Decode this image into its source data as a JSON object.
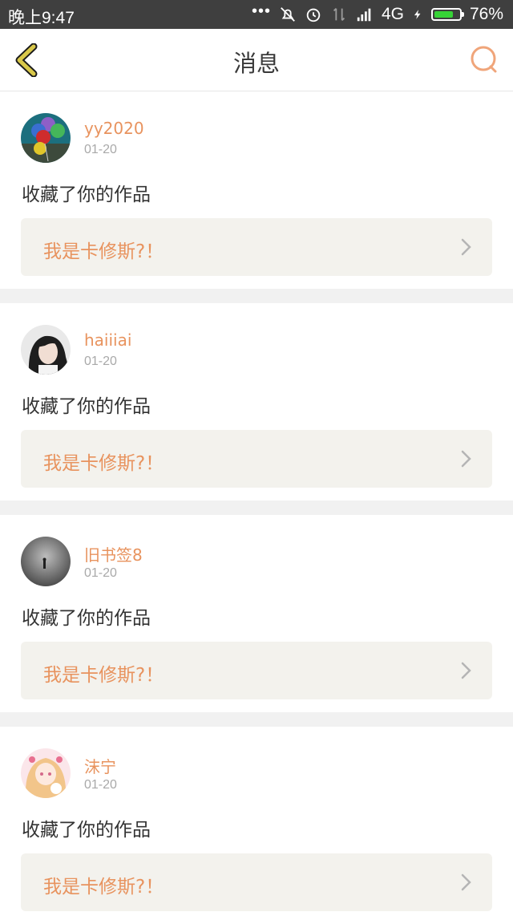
{
  "status_bar": {
    "time": "晚上9:47",
    "dots": "•••",
    "network": "4G",
    "battery": "76%",
    "battery_level": 0.76
  },
  "header": {
    "title": "消息",
    "back_icon": "chevron-left-icon",
    "search_icon": "search-icon"
  },
  "colors": {
    "accent": "#e8935e",
    "back_icon": "#d9c84a",
    "card_bg": "#f3f2ed",
    "divider": "#f1f1f1"
  },
  "notifications": [
    {
      "username": "yy2020",
      "date": "01-20",
      "action": "收藏了你的作品",
      "work_title": "我是卡修斯?！"
    },
    {
      "username": "haiiiai",
      "date": "01-20",
      "action": "收藏了你的作品",
      "work_title": "我是卡修斯?！"
    },
    {
      "username": "旧书签8",
      "date": "01-20",
      "action": "收藏了你的作品",
      "work_title": "我是卡修斯?！"
    },
    {
      "username": "沫宁",
      "date": "01-20",
      "action": "收藏了你的作品",
      "work_title": "我是卡修斯?！"
    }
  ]
}
